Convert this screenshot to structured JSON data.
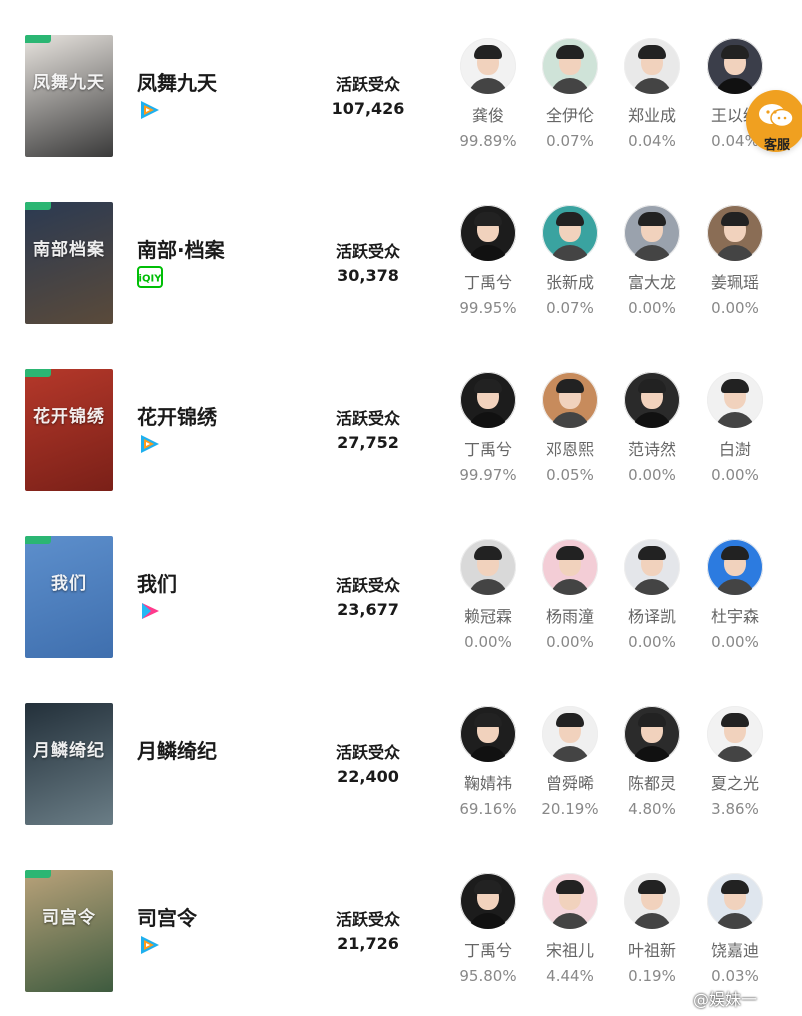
{
  "shows": [
    {
      "title": "凤舞九天",
      "poster_text": "凤舞九天",
      "poster_colors": [
        "#e8e4df",
        "#3a3a3a"
      ],
      "platform_icon": "tencent-video-icon",
      "audience_label": "活跃受众",
      "audience_count": "107,426",
      "actors": [
        {
          "name": "龚俊",
          "pct": "99.89%",
          "bg": "#f2f2f2"
        },
        {
          "name": "全伊伦",
          "pct": "0.07%",
          "bg": "#cfe3d8"
        },
        {
          "name": "郑业成",
          "pct": "0.04%",
          "bg": "#e9e9e9"
        },
        {
          "name": "王以纶",
          "pct": "0.04%",
          "bg": "#3b3e4a"
        }
      ]
    },
    {
      "title": "南部·档案",
      "poster_text": "南部档案",
      "poster_colors": [
        "#2b3a52",
        "#5a4a3a"
      ],
      "platform_icon": "iqiyi-icon",
      "audience_label": "活跃受众",
      "audience_count": "30,378",
      "actors": [
        {
          "name": "丁禹兮",
          "pct": "99.95%",
          "bg": "#1c1c1c"
        },
        {
          "name": "张新成",
          "pct": "0.07%",
          "bg": "#3aa3a0"
        },
        {
          "name": "富大龙",
          "pct": "0.00%",
          "bg": "#9aa2ad"
        },
        {
          "name": "姜珮瑶",
          "pct": "0.00%",
          "bg": "#8a6d55"
        }
      ]
    },
    {
      "title": "花开锦绣",
      "poster_text": "花开锦绣",
      "poster_colors": [
        "#b5382a",
        "#7a2018"
      ],
      "platform_icon": "tencent-video-icon",
      "audience_label": "活跃受众",
      "audience_count": "27,752",
      "actors": [
        {
          "name": "丁禹兮",
          "pct": "99.97%",
          "bg": "#1c1c1c"
        },
        {
          "name": "邓恩熙",
          "pct": "0.05%",
          "bg": "#c78b5c"
        },
        {
          "name": "范诗然",
          "pct": "0.00%",
          "bg": "#2a2a2a"
        },
        {
          "name": "白澍",
          "pct": "0.00%",
          "bg": "#f1f1f1"
        }
      ]
    },
    {
      "title": "我们",
      "poster_text": "我们",
      "poster_colors": [
        "#5d8fcc",
        "#3f6fae"
      ],
      "platform_icon": "youku-icon",
      "audience_label": "活跃受众",
      "audience_count": "23,677",
      "actors": [
        {
          "name": "赖冠霖",
          "pct": "0.00%",
          "bg": "#d9d9d9"
        },
        {
          "name": "杨雨潼",
          "pct": "0.00%",
          "bg": "#f3cdd6"
        },
        {
          "name": "杨译凯",
          "pct": "0.00%",
          "bg": "#e4e6ea"
        },
        {
          "name": "杜宇森",
          "pct": "0.00%",
          "bg": "#2c7be0"
        }
      ]
    },
    {
      "title": "月鳞绮纪",
      "poster_text": "月鳞绮纪",
      "poster_colors": [
        "#23303a",
        "#6a7d86"
      ],
      "platform_icon": "",
      "audience_label": "活跃受众",
      "audience_count": "22,400",
      "actors": [
        {
          "name": "鞠婧祎",
          "pct": "69.16%",
          "bg": "#1e1e1e"
        },
        {
          "name": "曾舜晞",
          "pct": "20.19%",
          "bg": "#f0f0f0"
        },
        {
          "name": "陈都灵",
          "pct": "4.80%",
          "bg": "#2b2b2b"
        },
        {
          "name": "夏之光",
          "pct": "3.86%",
          "bg": "#f2f2f2"
        }
      ]
    },
    {
      "title": "司宫令",
      "poster_text": "司宫令",
      "poster_colors": [
        "#b9a27a",
        "#3e5b3f"
      ],
      "platform_icon": "tencent-video-icon",
      "audience_label": "活跃受众",
      "audience_count": "21,726",
      "actors": [
        {
          "name": "丁禹兮",
          "pct": "95.80%",
          "bg": "#1c1c1c"
        },
        {
          "name": "宋祖儿",
          "pct": "4.44%",
          "bg": "#f4d6dc"
        },
        {
          "name": "叶祖新",
          "pct": "0.19%",
          "bg": "#ececec"
        },
        {
          "name": "饶嘉迪",
          "pct": "0.03%",
          "bg": "#dfe6ee"
        }
      ]
    }
  ],
  "customer_service": {
    "label": "客服",
    "icon": "chat-bubble-icon",
    "color": "#f0a020"
  },
  "watermark": "@娱妹一"
}
